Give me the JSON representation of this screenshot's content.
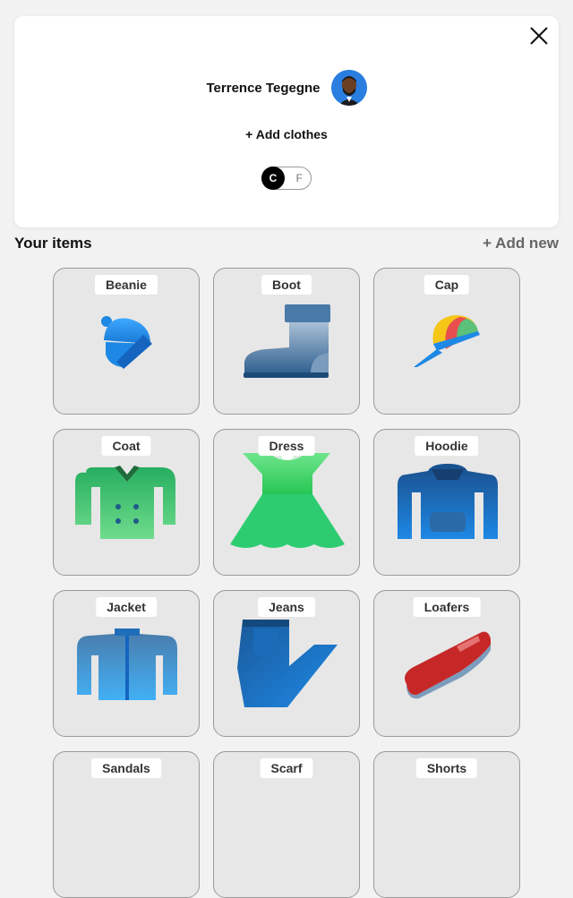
{
  "profile": {
    "name": "Terrence Tegegne",
    "add_clothes_label": "+ Add clothes",
    "unit_toggle": {
      "on_label": "C",
      "off_label": "F"
    }
  },
  "items_section": {
    "title": "Your items",
    "add_new_label": "+ Add new"
  },
  "items": [
    {
      "label": "Beanie",
      "icon": "beanie-icon"
    },
    {
      "label": "Boot",
      "icon": "boot-icon"
    },
    {
      "label": "Cap",
      "icon": "cap-icon"
    },
    {
      "label": "Coat",
      "icon": "coat-icon"
    },
    {
      "label": "Dress",
      "icon": "dress-icon"
    },
    {
      "label": "Hoodie",
      "icon": "hoodie-icon"
    },
    {
      "label": "Jacket",
      "icon": "jacket-icon"
    },
    {
      "label": "Jeans",
      "icon": "jeans-icon"
    },
    {
      "label": "Loafers",
      "icon": "loafers-icon"
    },
    {
      "label": "Sandals",
      "icon": "sandals-icon"
    },
    {
      "label": "Scarf",
      "icon": "scarf-icon"
    },
    {
      "label": "Shorts",
      "icon": "shorts-icon"
    }
  ],
  "colors": {
    "background": "#f2f2f2",
    "card": "#ffffff",
    "tile": "#e7e7e7",
    "blue": "#1e88e5",
    "green": "#2ecc71"
  }
}
